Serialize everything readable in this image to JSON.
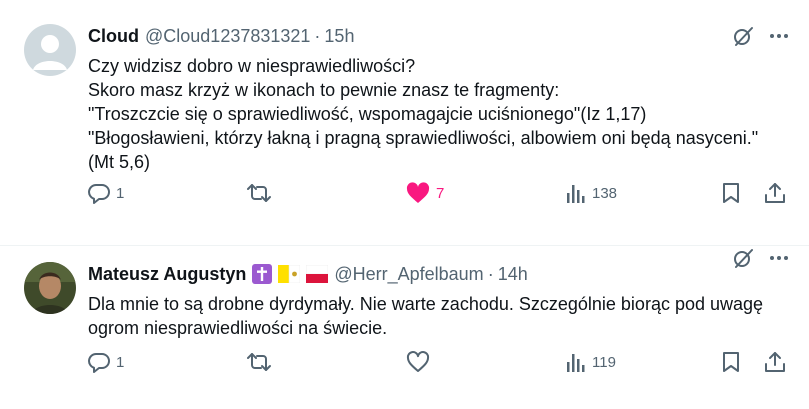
{
  "tweets": [
    {
      "name": "Cloud",
      "handle": "@Cloud1237831321",
      "dot": "·",
      "time": "15h",
      "text": "Czy widzisz dobro w niesprawiedliwości?\nSkoro masz krzyż w ikonach to pewnie znasz te fragmenty:\n\"Troszczcie się o sprawiedliwość, wspomagajcie uciśnionego\"(Iz 1,17)\n\"Błogosławieni, którzy łakną i pragną sprawiedliwości, albowiem oni będą nasyceni.\" (Mt 5,6)",
      "replies": "1",
      "retweets": "",
      "likes": "7",
      "views": "138",
      "liked": true,
      "avatar": "default-avatar"
    },
    {
      "name": "Mateusz Augustyn",
      "handle": "@Herr_Apfelbaum",
      "dot": "·",
      "time": "14h",
      "badges": [
        "latin-cross-emoji",
        "vatican-flag-emoji",
        "poland-flag-emoji"
      ],
      "text": "Dla mnie to są drobne dyrdymały. Nie warte zachodu. Szczególnie biorąc pod uwagę ogrom niesprawiedliwości na świecie.",
      "replies": "1",
      "retweets": "",
      "likes": "",
      "views": "119",
      "liked": false,
      "avatar": "photo-avatar"
    }
  ],
  "colors": {
    "text": "#0f1419",
    "muted": "#536471",
    "like": "#f91880",
    "cross_badge": "#9b59d0",
    "vatican_yellow": "#ffe000",
    "poland_red": "#dc143c"
  }
}
